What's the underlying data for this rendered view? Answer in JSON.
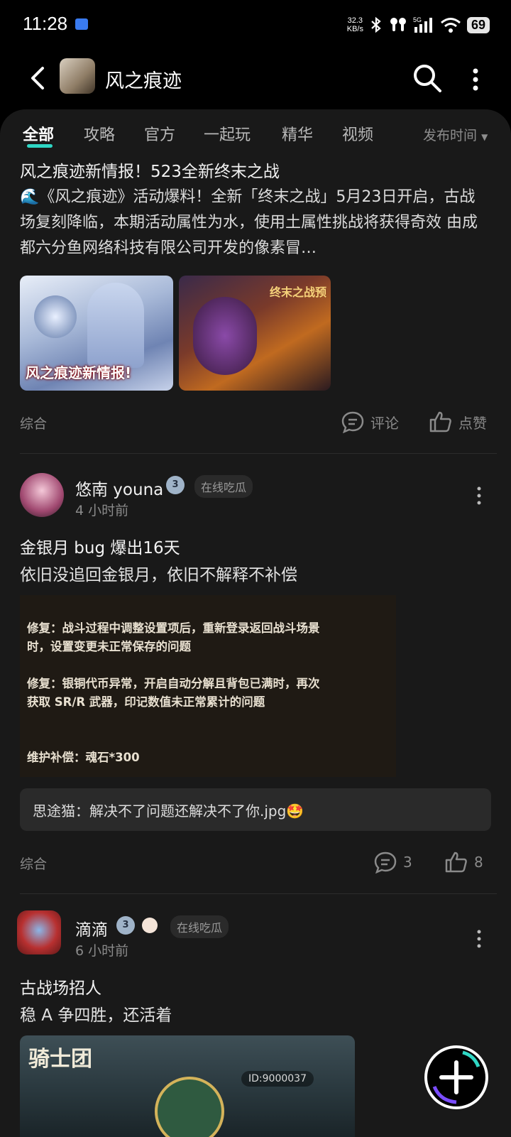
{
  "status_bar": {
    "time": "11:28",
    "net_speed_value": "32.3",
    "net_speed_unit": "KB/s",
    "signal": "5G",
    "battery": "69"
  },
  "header": {
    "title": "风之痕迹"
  },
  "tabs": [
    {
      "label": "全部",
      "active": true
    },
    {
      "label": "攻略"
    },
    {
      "label": "官方"
    },
    {
      "label": "一起玩"
    },
    {
      "label": "精华"
    },
    {
      "label": "视频"
    }
  ],
  "sort": {
    "label": "发布时间"
  },
  "post1": {
    "title": "风之痕迹新情报！523全新终末之战",
    "body": "🌊《风之痕迹》活动爆料！全新「终末之战」5月23日开启，古战场复刻降临，本期活动属性为水，使用土属性挑战将获得奇效 由成都六分鱼网络科技有限公司开发的像素冒…",
    "image1_caption": "风之痕迹新情报!",
    "image2_caption": "终末之战预",
    "category": "综合",
    "comment_label": "评论",
    "like_label": "点赞"
  },
  "post2": {
    "author": "悠南 youna",
    "level": "3",
    "badge": "在线吃瓜",
    "time": "4 小时前",
    "title": "金银月 bug 爆出16天",
    "body": "依旧没追回金银月，依旧不解释不补偿",
    "screenshot_lines": [
      "修复：战斗过程中调整设置项后，重新登录返回战斗场景",
      "时，设置变更未正常保存的问题",
      "修复：银铜代币异常，开启自动分解且背包已满时，再次",
      "获取 SR/R 武器，印记数值未正常累计的问题",
      "维护补偿：魂石*300"
    ],
    "top_comment": "思途猫：解决不了问题还解决不了你.jpg🤩",
    "category": "综合",
    "comment_count": "3",
    "like_count": "8"
  },
  "post3": {
    "author": "滴滴",
    "level": "3",
    "badge": "在线吃瓜",
    "time": "6 小时前",
    "title": "古战场招人",
    "body": "稳 A 争四胜，还活着",
    "image_title": "骑士团",
    "image_id": "ID:9000037"
  },
  "colors": {
    "accent": "#2fd6c4",
    "background": "#000000",
    "card": "#191919"
  }
}
